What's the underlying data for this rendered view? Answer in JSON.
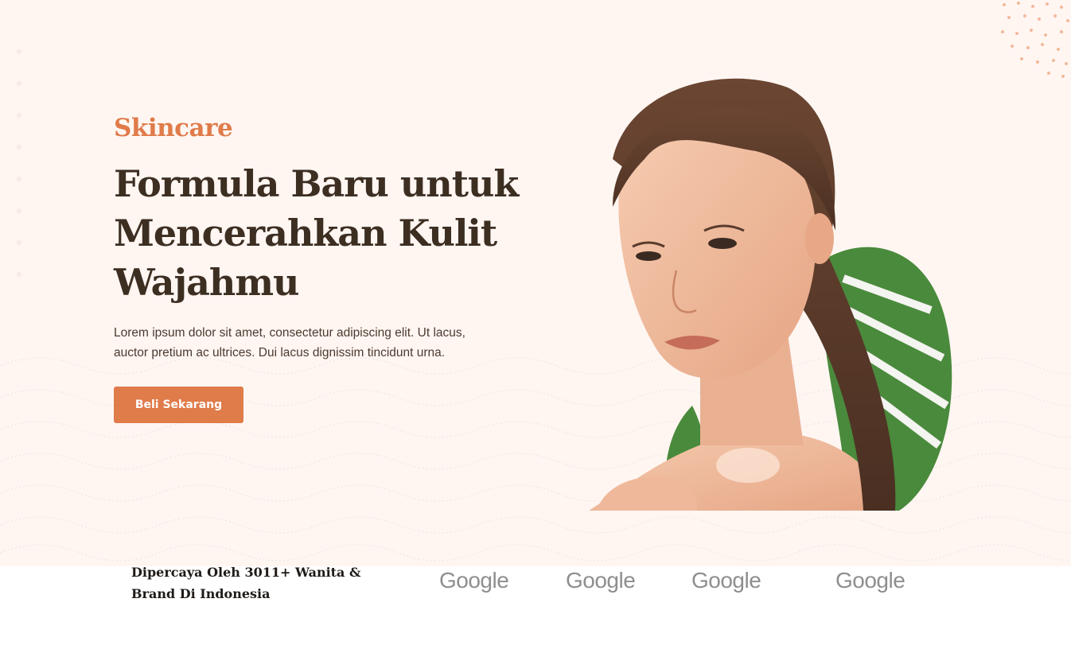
{
  "hero": {
    "eyebrow": "Skincare",
    "headline_line1": "Formula Baru untuk",
    "headline_line2": "Mencerahkan Kulit",
    "headline_line3": "Wajahmu",
    "description_line1": "Lorem ipsum dolor sit amet, consectetur adipiscing elit. Ut lacus,",
    "description_line2": "auctor pretium ac ultrices. Dui lacus dignissim tincidunt urna.",
    "cta_label": "Beli Sekarang"
  },
  "trusted": {
    "line1": "Dipercaya Oleh 3011+ Wanita &",
    "line2": "Brand Di Indonesia"
  },
  "logos": [
    {
      "label": "Google"
    },
    {
      "label": "Google"
    },
    {
      "label": "Google"
    },
    {
      "label": "Google"
    }
  ],
  "colors": {
    "accent": "#e07b4a",
    "heading": "#3d2e22",
    "hero_background": "#fff6f2",
    "logo_gray": "#8e8e8e"
  }
}
